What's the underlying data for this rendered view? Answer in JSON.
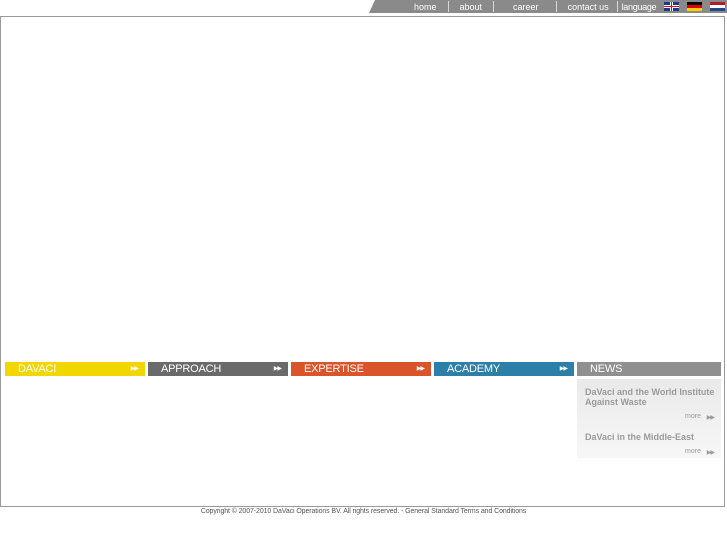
{
  "nav": {
    "items": [
      "home",
      "about",
      "career",
      "contact us"
    ],
    "language_label": "language",
    "flags": [
      "uk-flag-icon",
      "german-flag-icon",
      "dutch-flag-icon"
    ]
  },
  "sections": [
    {
      "label": "DAVACI",
      "color": "#f2d600"
    },
    {
      "label": "APPROACH",
      "color": "#6a6a6a"
    },
    {
      "label": "EXPERTISE",
      "color": "#d9532b"
    },
    {
      "label": "ACADEMY",
      "color": "#2c7fa6"
    },
    {
      "label": "NEWS",
      "color": "#8f8f8f"
    }
  ],
  "news": [
    {
      "title": "DaVaci and the World Institute Against Waste",
      "more": "more"
    },
    {
      "title": "DaVaci in the Middle-East",
      "more": "more"
    }
  ],
  "footer": {
    "copyright": "Copyright © 2007-2010 DaVaci Operations BV. All rights reserved. - ",
    "terms": "General Standard Terms and Conditions"
  }
}
